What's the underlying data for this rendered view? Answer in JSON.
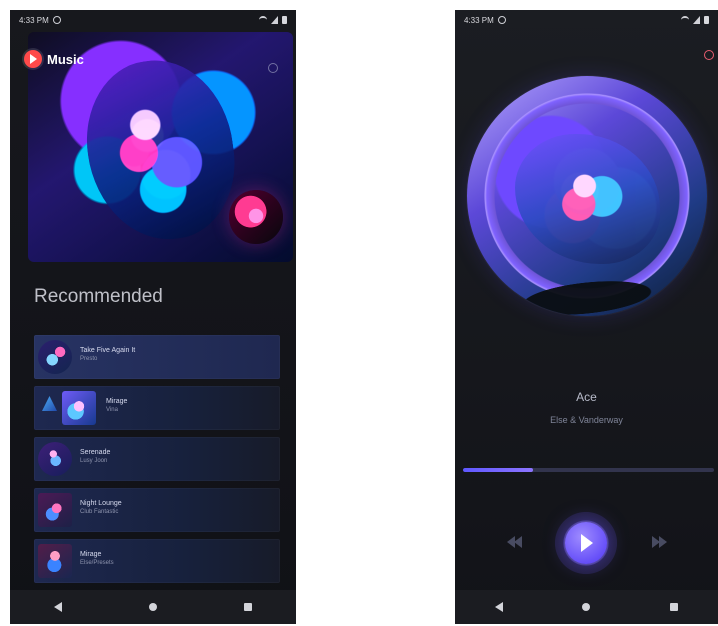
{
  "left_screen": {
    "status_time": "4:33 PM",
    "brand_name": "Music",
    "section_title": "Recommended",
    "recommended_items": [
      {
        "title": "Take Five Again It",
        "artist": "Presto"
      },
      {
        "title": "Mirage",
        "artist": "Vina"
      },
      {
        "title": "Serenade",
        "artist": "Lusy Joon"
      },
      {
        "title": "Night Lounge",
        "artist": "Club Fantastic"
      },
      {
        "title": "Mirage",
        "artist": "Else/Presets"
      }
    ]
  },
  "right_screen": {
    "status_time": "4:33 PM",
    "now_playing": {
      "title": "Ace",
      "artist": "Else & Vanderway",
      "progress": 0.28
    }
  },
  "icons": {
    "brand_logo": "youtube-music-icon",
    "settings": "gear-icon",
    "wifi": "wifi-icon",
    "signal": "signal-icon",
    "battery": "battery-icon",
    "back": "back-icon",
    "home": "home-icon",
    "recents": "recents-icon",
    "previous": "previous-icon",
    "play": "play-icon",
    "next": "next-icon",
    "record_button": "record-icon"
  },
  "colors": {
    "accent": "#6B56F9",
    "brand_red": "#FF4A4A",
    "background": "#121317"
  }
}
